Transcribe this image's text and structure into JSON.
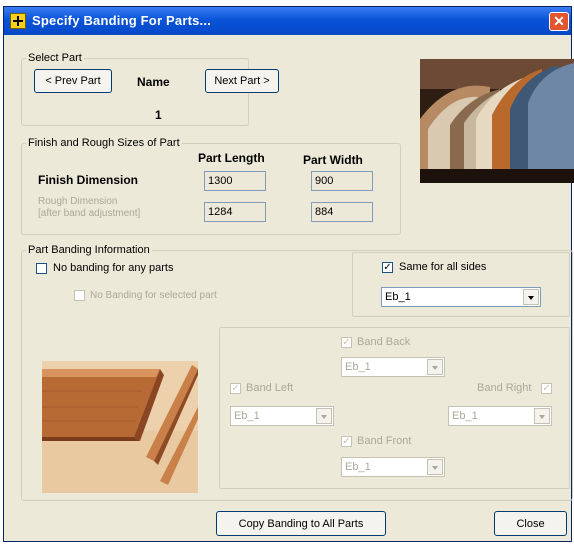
{
  "window": {
    "title": "Specify Banding For Parts..."
  },
  "select_part": {
    "legend": "Select Part",
    "prev_label": "< Prev Part",
    "next_label": "Next Part >",
    "name_label": "Name",
    "part_number": "1"
  },
  "sizes": {
    "legend": "Finish and Rough Sizes of Part",
    "col_length": "Part Length",
    "col_width": "Part Width",
    "finish_label": "Finish Dimension",
    "rough_label_1": "Rough Dimension",
    "rough_label_2": "[after band adjustment]",
    "finish_length": "1300",
    "finish_width": "900",
    "rough_length": "1284",
    "rough_width": "884"
  },
  "banding": {
    "legend": "Part Banding Information",
    "no_banding_label": "No banding for any parts",
    "no_banding_checked": false,
    "no_banding_selected_label": "No Banding for selected part",
    "same_all_label": "Same for all sides",
    "same_all_checked": true,
    "all_sides_value": "Eb_1",
    "back_label": "Band Back",
    "back_value": "Eb_1",
    "left_label": "Band Left",
    "left_value": "Eb_1",
    "right_label": "Band Right",
    "right_value": "Eb_1",
    "front_label": "Band Front",
    "front_value": "Eb_1"
  },
  "footer": {
    "copy_label": "Copy Banding to All Parts",
    "close_label": "Close"
  },
  "colors": {
    "title_bar": "#0a54d8",
    "dialog_bg": "#ece9d8",
    "close_button": "#e2552f"
  }
}
